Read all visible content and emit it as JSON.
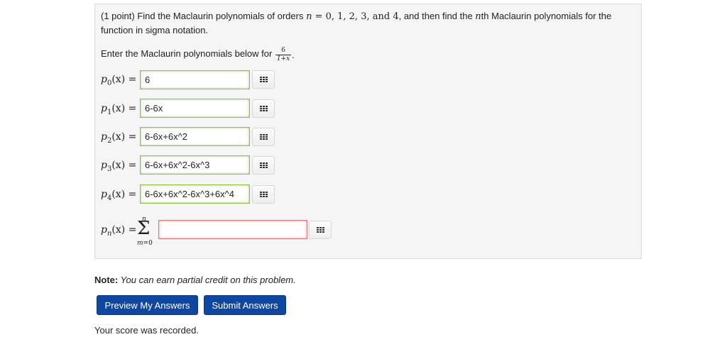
{
  "problem": {
    "points": "(1 point)",
    "intro_a": "Find the Maclaurin polynomials of orders ",
    "orders_var": "n",
    "orders_values": " = 0, 1, 2, 3, and 4",
    "intro_b": ", and then find the ",
    "nth_var": "n",
    "intro_c": "th Maclaurin polynomials for the",
    "line2": "function in sigma notation.",
    "enter_text": "Enter the Maclaurin polynomials below for",
    "frac_numerator": "6",
    "frac_denominator": "1+x",
    "frac_end": "."
  },
  "rows": [
    {
      "func": "p",
      "sub": "0",
      "arg": "(x) =",
      "value": "6"
    },
    {
      "func": "p",
      "sub": "1",
      "arg": "(x) =",
      "value": "6-6x"
    },
    {
      "func": "p",
      "sub": "2",
      "arg": "(x) =",
      "value": "6-6x+6x^2"
    },
    {
      "func": "p",
      "sub": "3",
      "arg": "(x) =",
      "value": "6-6x+6x^2-6x^3"
    },
    {
      "func": "p",
      "sub": "4",
      "arg": "(x) =",
      "value": "6-6x+6x^2-6x^3+6x^4"
    }
  ],
  "nth_row": {
    "func": "p",
    "sub": "n",
    "arg": "(x) =",
    "sigma": "Σ",
    "sigma_top": "n",
    "sigma_bottom_var": "m",
    "sigma_bottom_val": "=0",
    "value": ""
  },
  "icons": {
    "matrix_button": "grid-icon"
  },
  "note": {
    "label": "Note:",
    "text": " You can earn partial credit on this problem."
  },
  "buttons": {
    "preview": "Preview My Answers",
    "submit": "Submit Answers"
  },
  "score_text": "Your score was recorded.",
  "colors": {
    "button_bg": "#0d47a1",
    "valid_border": "#8bc34a",
    "invalid_border": "#e57373"
  }
}
